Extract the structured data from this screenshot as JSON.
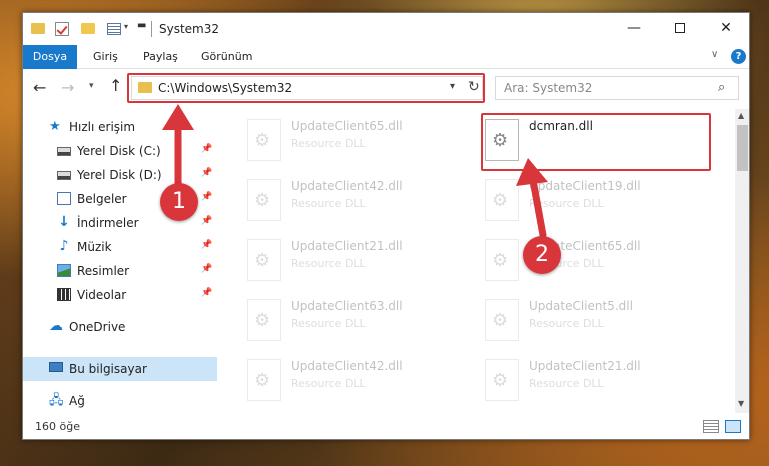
{
  "window": {
    "title": "System32",
    "min_glyph": "—",
    "close_glyph": "✕"
  },
  "ribbon": {
    "tabs": [
      "Dosya",
      "Giriş",
      "Paylaş",
      "Görünüm"
    ],
    "help_label": "?"
  },
  "nav": {
    "address": "C:\\Windows\\System32",
    "search_placeholder": "Ara: System32"
  },
  "sidebar": {
    "items": [
      {
        "label": "Hızlı erişim",
        "icon": "star-icon"
      },
      {
        "label": "Yerel Disk (C:)",
        "icon": "drive-icon",
        "pinned": true
      },
      {
        "label": "Yerel Disk (D:)",
        "icon": "drive-icon",
        "pinned": true
      },
      {
        "label": "Belgeler",
        "icon": "documents-icon",
        "pinned": true
      },
      {
        "label": "İndirmeler",
        "icon": "download-icon",
        "pinned": true
      },
      {
        "label": "Müzik",
        "icon": "music-icon",
        "pinned": true
      },
      {
        "label": "Resimler",
        "icon": "pictures-icon",
        "pinned": true
      },
      {
        "label": "Videolar",
        "icon": "videos-icon",
        "pinned": true
      },
      {
        "label": "OneDrive",
        "icon": "cloud-icon"
      },
      {
        "label": "Bu bilgisayar",
        "icon": "computer-icon",
        "selected": true
      },
      {
        "label": "Ağ",
        "icon": "network-icon"
      }
    ]
  },
  "files": [
    {
      "name": "UpdateClient65.dll",
      "desc": "Resource DLL",
      "faded": true
    },
    {
      "name": "dcmran.dll",
      "desc": "",
      "faded": false
    },
    {
      "name": "UpdateClient42.dll",
      "desc": "Resource DLL",
      "faded": true
    },
    {
      "name": "UpdateClient19.dll",
      "desc": "Resource DLL",
      "faded": true
    },
    {
      "name": "UpdateClient21.dll",
      "desc": "Resource DLL",
      "faded": true
    },
    {
      "name": "UpdateClient65.dll",
      "desc": "Resource DLL",
      "faded": true
    },
    {
      "name": "UpdateClient63.dll",
      "desc": "Resource DLL",
      "faded": true
    },
    {
      "name": "UpdateClient5.dll",
      "desc": "Resource DLL",
      "faded": true
    },
    {
      "name": "UpdateClient42.dll",
      "desc": "Resource DLL",
      "faded": true
    },
    {
      "name": "UpdateClient21.dll",
      "desc": "Resource DLL",
      "faded": true
    }
  ],
  "status": {
    "item_count": "160 öğe"
  },
  "annotations": {
    "step1": "1",
    "step2": "2",
    "color": "#d8363a"
  }
}
